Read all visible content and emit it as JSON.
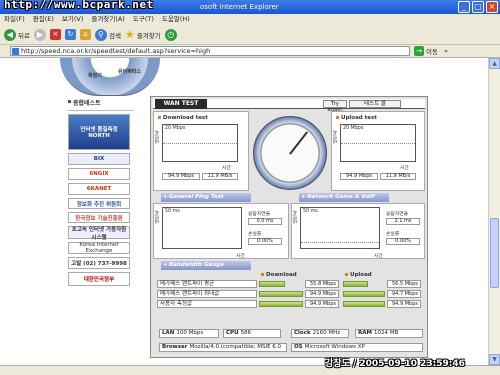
{
  "window": {
    "watermark": "http://www.bcpark.net",
    "title": "osoft Internet Explorer"
  },
  "menu": [
    "파일(F)",
    "편집(E)",
    "보기(V)",
    "즐겨찾기(A)",
    "도구(T)",
    "도움말(H)"
  ],
  "toolbar": {
    "back": "뒤로",
    "search": "검색",
    "favorites": "즐겨찾기"
  },
  "address": {
    "url": "http://speed.nca.or.kr/speedtest/default.asp?service=high",
    "go": "이동",
    "links": "»"
  },
  "logo": {
    "a": "측정기",
    "b": "유비쿼터스"
  },
  "sidebar": {
    "title": "종합테스트",
    "items": [
      "인터넷 품질측정 NORTH",
      "BIX",
      "6NGIX",
      "6KANET",
      "정보화 추진 위원회",
      "한국정보 기술진흥원",
      "초고속 인터넷 가용자원 시스템",
      "Korea Internet Exchange",
      "고발 (02) 737-9998",
      "대한민국정부"
    ]
  },
  "main": {
    "tab": "WAN TEST",
    "try_again": "Try again",
    "test_all": "테스트 블",
    "download": {
      "title": "Download test",
      "axis_label": "대역폭",
      "scale": "20 Mbps",
      "time_label": "시간",
      "value_mbps": "94.9 Mbps",
      "value_mbs": "11.9 MB/s"
    },
    "upload": {
      "title": "Upload test",
      "axis_label": "대역폭",
      "scale": "20 Mbps",
      "time_label": "시간",
      "value_mbps": "94.9 Mbps",
      "value_mbs": "11.9 MB/s"
    },
    "ping": {
      "title": "General Ping Test",
      "axis_label": "대역폭",
      "scale": "50 ms",
      "time_label": "시간",
      "jitter_label": "응답지연율",
      "jitter": "0.0 ms",
      "loss_label": "손실률",
      "loss": "0.00%"
    },
    "game": {
      "title": "Network Game & VoIP Test",
      "axis_label": "대역폭",
      "scale": "50 ms",
      "time_label": "시간",
      "jitter_label": "응답지연율",
      "jitter": "2.1 ms",
      "loss_label": "손실률",
      "loss": "0.00%"
    },
    "bandwidth": {
      "title": "Bandwidth Gauge",
      "col_download": "Download",
      "col_upload": "Upload",
      "rows": [
        {
          "label": "메가패스 랜트파이 평균",
          "down": "55.8 Mbps",
          "down_frac": 0.59,
          "up": "56.5 Mbps",
          "up_frac": 0.6
        },
        {
          "label": "메가패스 랜트파이 최대값",
          "down": "94.9 Mbps",
          "down_frac": 1.0,
          "up": "94.7 Mbps",
          "up_frac": 1.0
        },
        {
          "label": "사용자 측정값",
          "down": "94.9 Mbps",
          "down_frac": 1.0,
          "up": "94.9 Mbps",
          "up_frac": 1.0
        }
      ]
    },
    "system": {
      "lan_label": "LAN",
      "lan": "100 Mbps",
      "cpu_label": "CPU",
      "cpu": "586",
      "clock_label": "Clock",
      "clock": "2160 MHz",
      "ram_label": "RAM",
      "ram": "1024 MB",
      "browser_label": "Browser",
      "browser": "Mozilla/4.0 (compatible; MSIE 6.0",
      "os_label": "OS",
      "os": "Microsoft Windows XP"
    }
  },
  "stamp": "강창도 / 2005-09-10 23:59:46",
  "colors": {
    "title": "#1d55d2",
    "bar": "#8bb33a",
    "section": "#8795c9"
  }
}
